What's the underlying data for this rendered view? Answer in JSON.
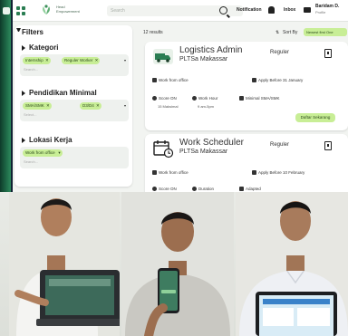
{
  "app": {
    "logo_text": "Head\nEmpowerment",
    "search_placeholder": "Search",
    "notification_label": "Notification",
    "inbox_label": "Inbox",
    "user_name": "Baridam D.",
    "user_sub": "Profile"
  },
  "filters": {
    "title": "Filters",
    "sections": [
      {
        "title": "Kategori",
        "chips": [
          "Internship",
          "Reguler Worker"
        ],
        "search": "Search..."
      },
      {
        "title": "Pendidikan Minimal",
        "chips": [
          "SMA/SMK",
          "D3/D4"
        ],
        "search": "Select..."
      },
      {
        "title": "Lokasi Kerja",
        "chips": [
          "Work from office"
        ],
        "search": "Search..."
      }
    ]
  },
  "results": {
    "count": "12 results",
    "sort_label": "Sort By",
    "sort_value": "Newest first One"
  },
  "jobs": [
    {
      "title": "Logistics Admin",
      "company": "PLTSa Makassar",
      "type": "Reguler",
      "location": "Work from office",
      "deadline": "Apply Before 31 January",
      "score_label": "Score ON",
      "work_hour_label": "Work Hour",
      "education_label": "Minimal SMA/SMK",
      "score_value": "15 Maksimal",
      "work_hour_value": "9 am-5pm",
      "apply_label": "Daftar Sekarang"
    },
    {
      "title": "Work Scheduler",
      "company": "PLTSa Makassar",
      "type": "Reguler",
      "location": "Work from office",
      "deadline": "Apply Before 10 February",
      "score_label": "Score ON",
      "work_hour_label": "Duration",
      "education_label": "Adapted"
    }
  ],
  "colors": {
    "accent": "#c8ee96",
    "brand": "#2a7d52",
    "panel": "#ffffff",
    "background": "#f2f4f1"
  }
}
